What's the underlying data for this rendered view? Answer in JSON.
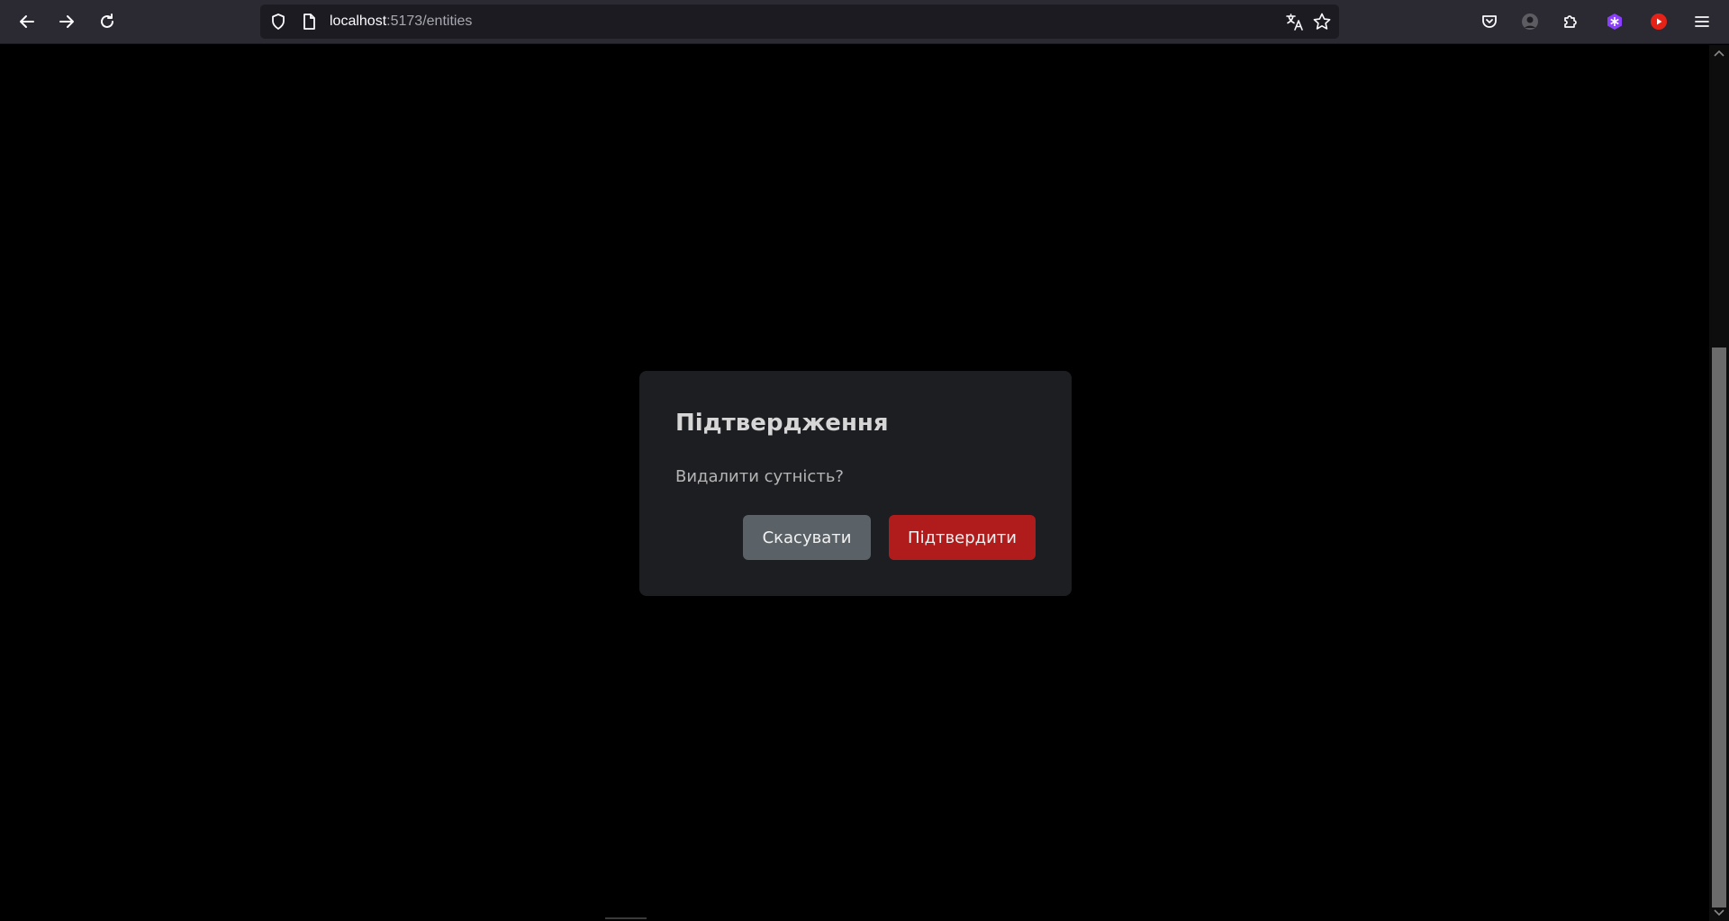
{
  "browser": {
    "url_host": "localhost",
    "url_path": ":5173/entities"
  },
  "dialog": {
    "title": "Підтвердження",
    "message": "Видалити сутність?",
    "cancel_label": "Скасувати",
    "confirm_label": "Підтвердити"
  },
  "colors": {
    "confirm": "#b01c1c",
    "cancel": "#5a6268",
    "modal_bg": "#1d1e21",
    "page_bg": "#000000"
  }
}
